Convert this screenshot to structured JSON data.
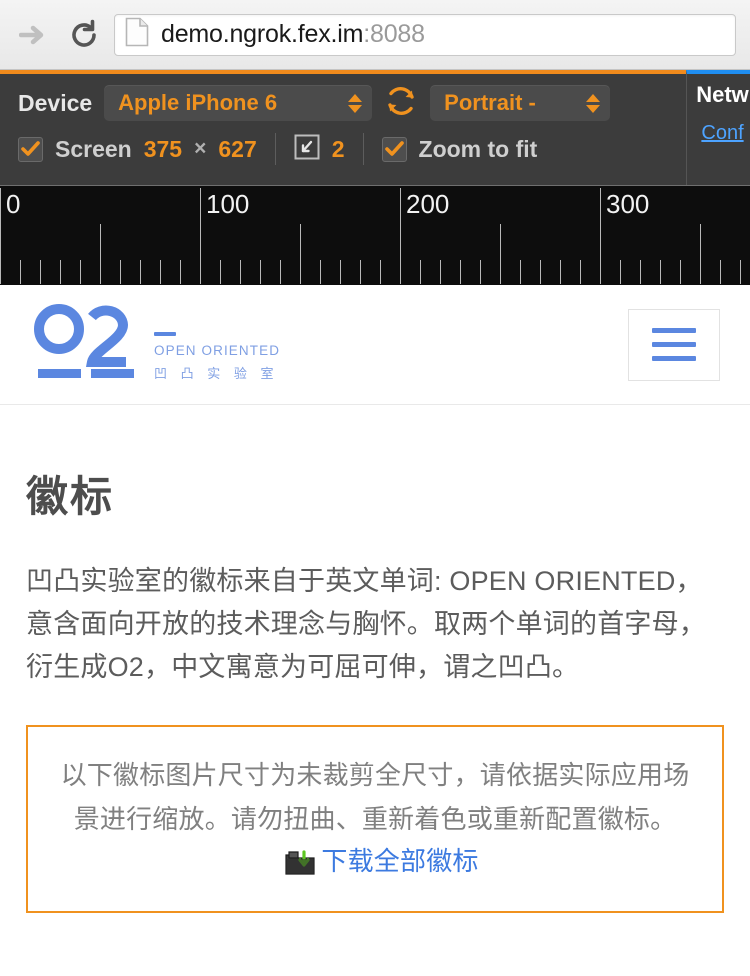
{
  "browser": {
    "forward_icon": "arrow-right-icon",
    "reload_icon": "reload-icon",
    "page_icon": "page-document-icon",
    "url_host": "demo.ngrok.fex.im",
    "url_port": ":8088"
  },
  "emulator": {
    "device_label": "Device",
    "device_value": "Apple iPhone 6",
    "rotate_icon": "rotate-icon",
    "orientation_value": "Portrait -",
    "screen_label": "Screen",
    "screen_checked": true,
    "screen_width": "375",
    "screen_x": "×",
    "screen_height": "627",
    "resize_icon": "resize-icon",
    "scale_value": "2",
    "zoom_to_fit_label": "Zoom to fit",
    "zoom_to_fit_checked": true,
    "network_title": "Netw",
    "network_link": "Conf",
    "accent_orange": "#f0921f",
    "accent_blue": "#1f8ef1"
  },
  "ruler": {
    "labels": [
      "0",
      "100",
      "200",
      "300"
    ],
    "label_positions": [
      0,
      200,
      400,
      600
    ],
    "major_step": 100,
    "minor_step": 20
  },
  "site": {
    "logo": {
      "mark": "o2-logo-icon",
      "english": "OPEN ORIENTED",
      "chinese": "凹 凸 实 验 室",
      "color": "#5b87e0"
    },
    "menu_button": "hamburger-menu-icon",
    "title": "徽标",
    "paragraph": "凹凸实验室的徽标来自于英文单词: OPEN ORIENTED，意含面向开放的技术理念与胸怀。取两个单词的首字母，衍生成O2，中文寓意为可屈可伸，谓之凹凸。",
    "notice": {
      "text": "以下徽标图片尺寸为未裁剪全尺寸，请依据实际应用场景进行缩放。请勿扭曲、重新着色或重新配置徽标。",
      "download_icon": "download-folder-icon",
      "download_label": "下载全部徽标",
      "border_color": "#f0921f",
      "link_color": "#3c7ae0"
    }
  }
}
